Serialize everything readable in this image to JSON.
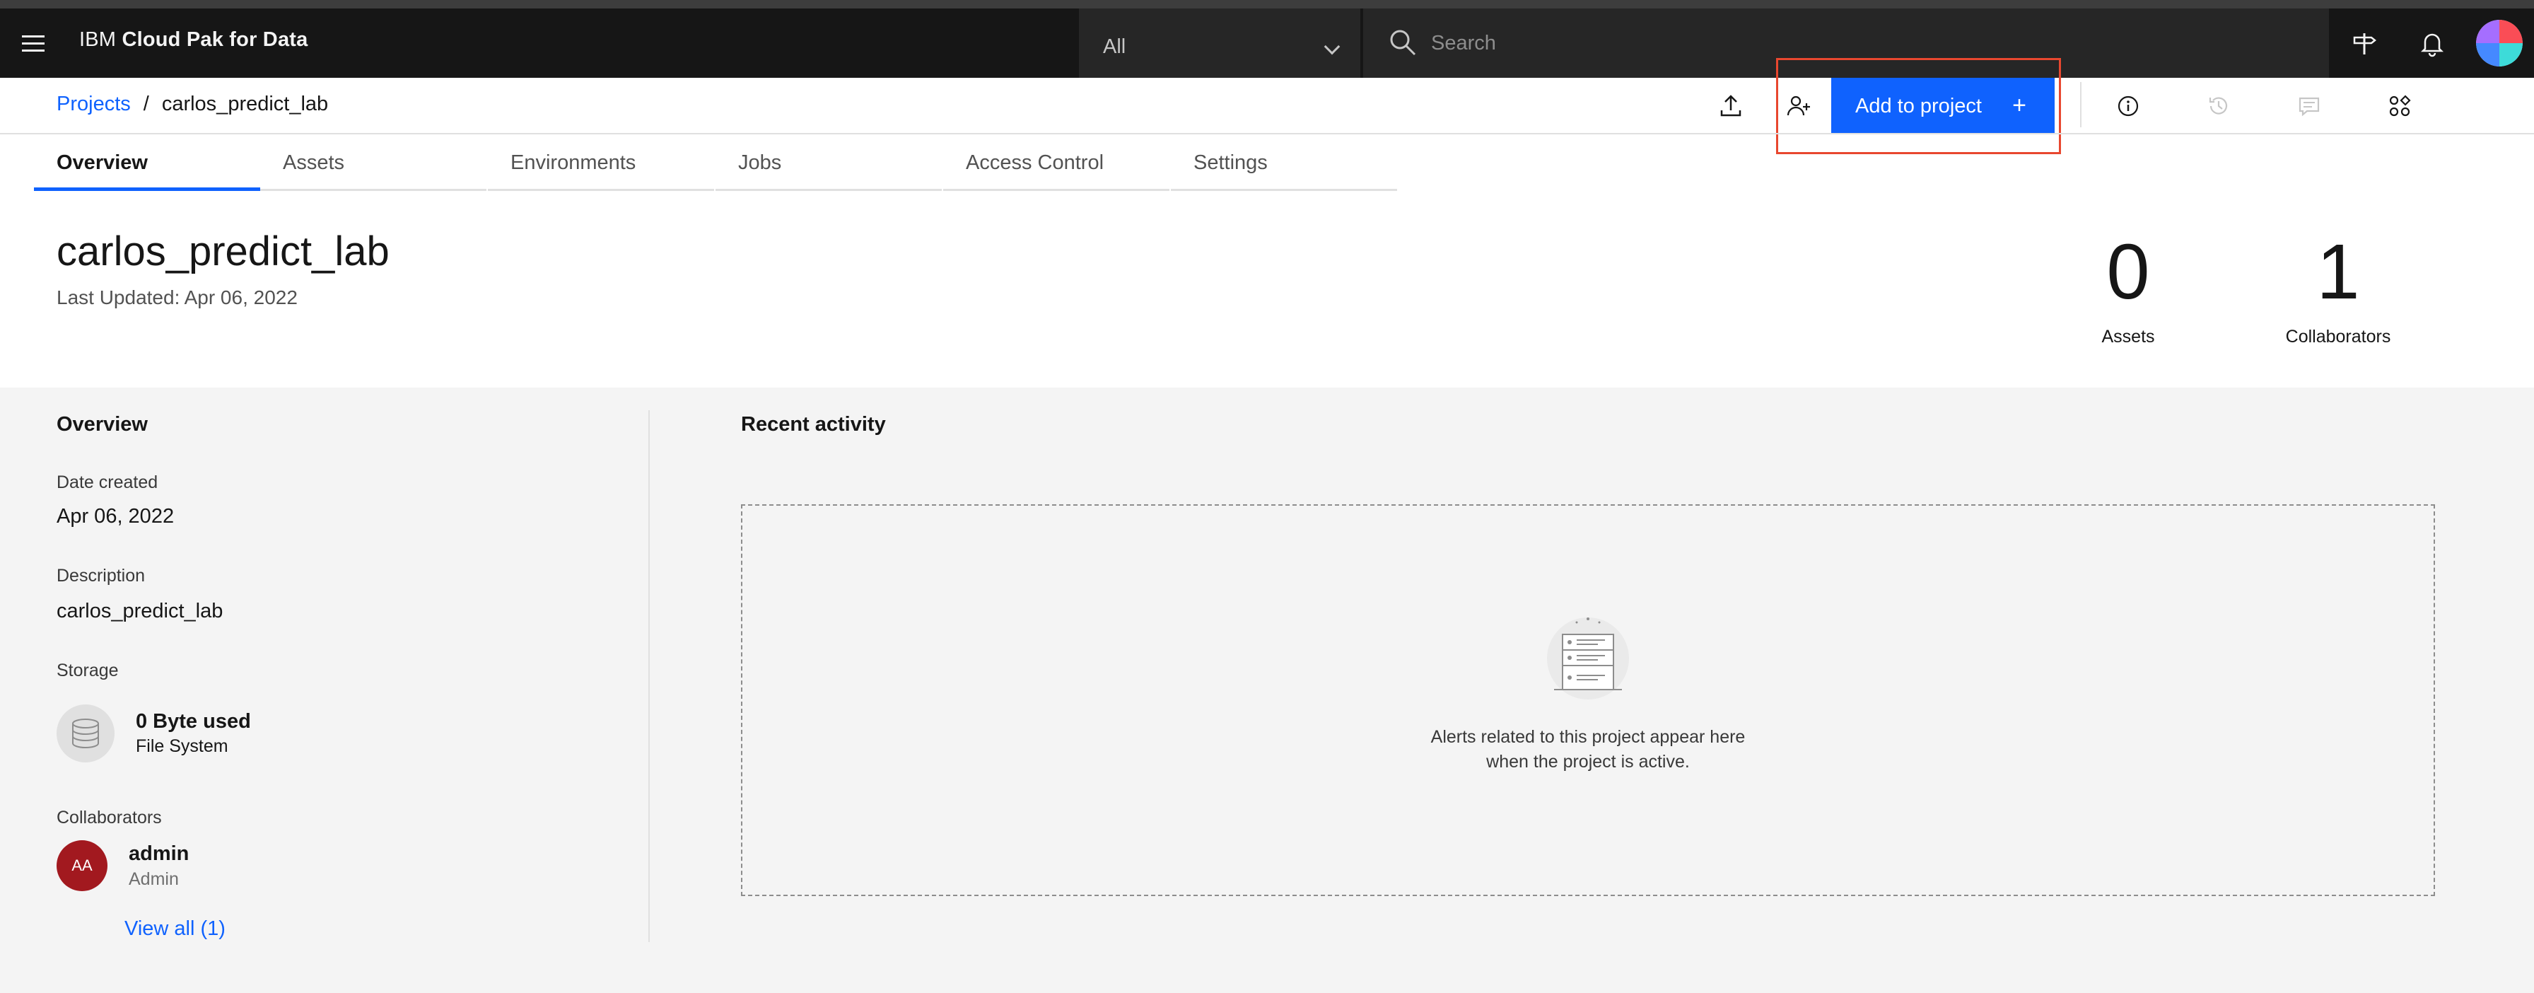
{
  "header": {
    "brand_prefix": "IBM",
    "brand_name": "Cloud Pak for Data",
    "scope_value": "All",
    "search_placeholder": "Search"
  },
  "breadcrumb": {
    "parent": "Projects",
    "separator": "/",
    "current": "carlos_predict_lab"
  },
  "toolbar": {
    "add_to_project_label": "Add to project",
    "add_plus": "+"
  },
  "tabs": [
    {
      "label": "Overview",
      "active": true
    },
    {
      "label": "Assets"
    },
    {
      "label": "Environments"
    },
    {
      "label": "Jobs"
    },
    {
      "label": "Access Control"
    },
    {
      "label": "Settings"
    }
  ],
  "project": {
    "name": "carlos_predict_lab",
    "last_updated": "Last Updated: Apr 06, 2022",
    "stats": [
      {
        "value": "0",
        "label": "Assets"
      },
      {
        "value": "1",
        "label": "Collaborators"
      }
    ]
  },
  "overview": {
    "heading": "Overview",
    "date_created_label": "Date created",
    "date_created": "Apr 06, 2022",
    "description_label": "Description",
    "description": "carlos_predict_lab",
    "storage_label": "Storage",
    "storage_used": "0 Byte used",
    "storage_type": "File System",
    "collaborators_label": "Collaborators",
    "collaborator": {
      "initials": "AA",
      "name": "admin",
      "role": "Admin"
    },
    "view_all": "View all (1)"
  },
  "activity": {
    "heading": "Recent activity",
    "empty_line1": "Alerts related to this project appear here",
    "empty_line2": "when the project is active."
  },
  "colors": {
    "accent": "#0f62fe",
    "highlight": "#e8472f",
    "collaborator_avatar": "#a2191f"
  }
}
